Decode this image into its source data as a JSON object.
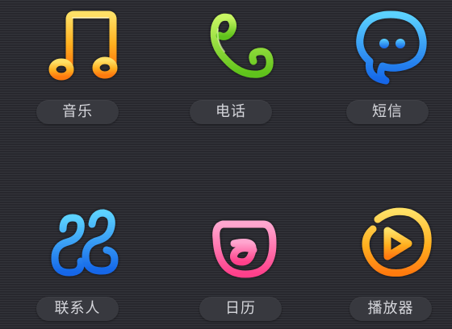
{
  "apps": [
    {
      "id": "music",
      "label": "音乐",
      "icon": "music-note-icon",
      "color": "#ffb020"
    },
    {
      "id": "phone",
      "label": "电话",
      "icon": "phone-icon",
      "color": "#7ed321"
    },
    {
      "id": "sms",
      "label": "短信",
      "icon": "chat-bubble-icon",
      "color": "#1e90ff"
    },
    {
      "id": "contacts",
      "label": "联系人",
      "icon": "contacts-icon",
      "color": "#1e90ff"
    },
    {
      "id": "calendar",
      "label": "日历",
      "icon": "calendar-icon",
      "color": "#ff5fa2"
    },
    {
      "id": "player",
      "label": "播放器",
      "icon": "play-circle-icon",
      "color": "#ffb020"
    }
  ]
}
